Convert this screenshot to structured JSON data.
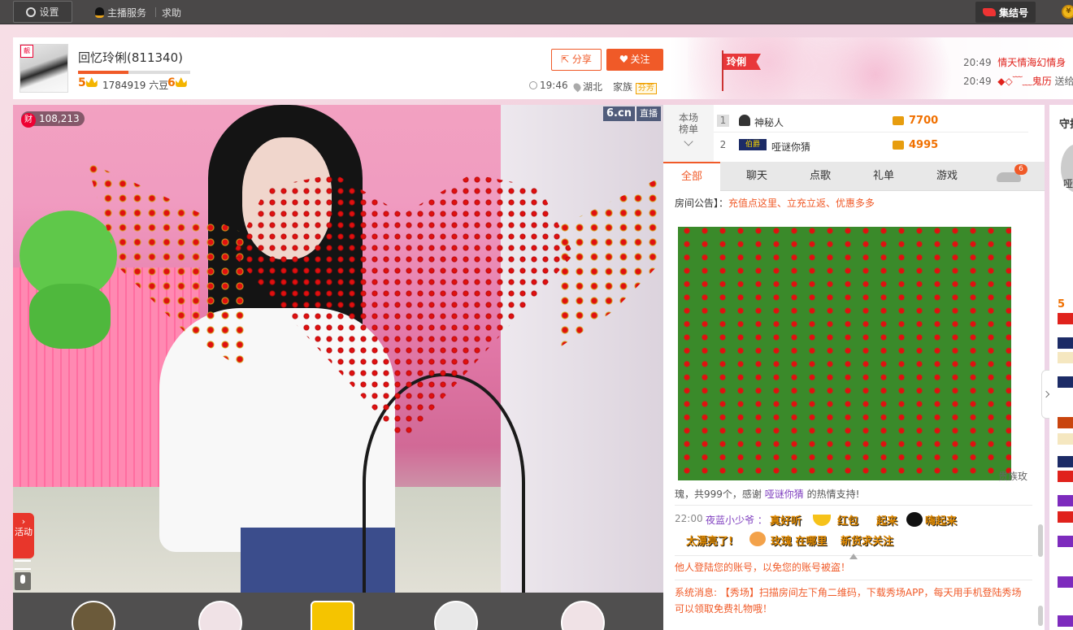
{
  "topbar": {
    "settings_label": "设置",
    "anchor_service": "主播服务",
    "help": "求助",
    "gather_label": "集结号"
  },
  "header": {
    "anchor_name": "回忆玲俐(811340)",
    "level_progress": 0.45,
    "anchor_level": "5",
    "beans": "1784919 六豆",
    "next_level": "6",
    "share_label": "分享",
    "follow_label": "关注",
    "time": "19:46",
    "location": "湖北",
    "family_label": "家族",
    "family_badge": "芬芳",
    "flag_text": "玲俐",
    "notices": [
      {
        "time": "20:49",
        "text": "情天情海幻情身"
      },
      {
        "time": "20:49",
        "text": "◆◇﹋﹏鬼历",
        "action": "送给"
      }
    ]
  },
  "video": {
    "wealth_icon": "财",
    "wealth_count": "108,213",
    "site_logo": "6.cn",
    "live_tag": "直播",
    "activity_label": "活动"
  },
  "rank": {
    "label": "本场榜单",
    "rows": [
      {
        "num": "1",
        "name": "神秘人",
        "value": "7700"
      },
      {
        "num": "2",
        "badge": "伯爵",
        "name": "哑谜你猜",
        "value": "4995"
      }
    ]
  },
  "tabs": [
    {
      "label": "全部",
      "active": true
    },
    {
      "label": "聊天"
    },
    {
      "label": "点歌"
    },
    {
      "label": "礼单"
    },
    {
      "label": "游戏"
    }
  ],
  "tabs_car_badge": "6",
  "chat": {
    "announce_prefix": "房间公告】：",
    "announce_text": "充值点这里、立充立返、优惠多多",
    "gift_tail": "贵族玫",
    "gift_line_pre": "瑰，共999个，感谢 ",
    "gift_line_user": "哑谜你猜",
    "gift_line_post": " 的热情支持!",
    "msg_time": "22:00",
    "msg_user": "夜蓝小少爷 ：",
    "msg_parts": [
      "真好听",
      "红包",
      "起来",
      "嗨起来",
      "太漂亮了!",
      "玫瑰 在哪里",
      "新货求关注"
    ],
    "sys1": "他人登陆您的账号，以免您的账号被盗！",
    "sys2": "系统消息: 【秀场】扫描房间左下角二维码，下载秀场APP，每天用手机登陆秀场可以领取免费礼物哦！"
  },
  "rail": {
    "title": "守护",
    "name": "哑谜你猜",
    "level": "5"
  },
  "colors": {
    "accent": "#f05a28",
    "topbar": "#4a4848",
    "rank_value": "#f07000",
    "username": "#7f3fbf"
  }
}
